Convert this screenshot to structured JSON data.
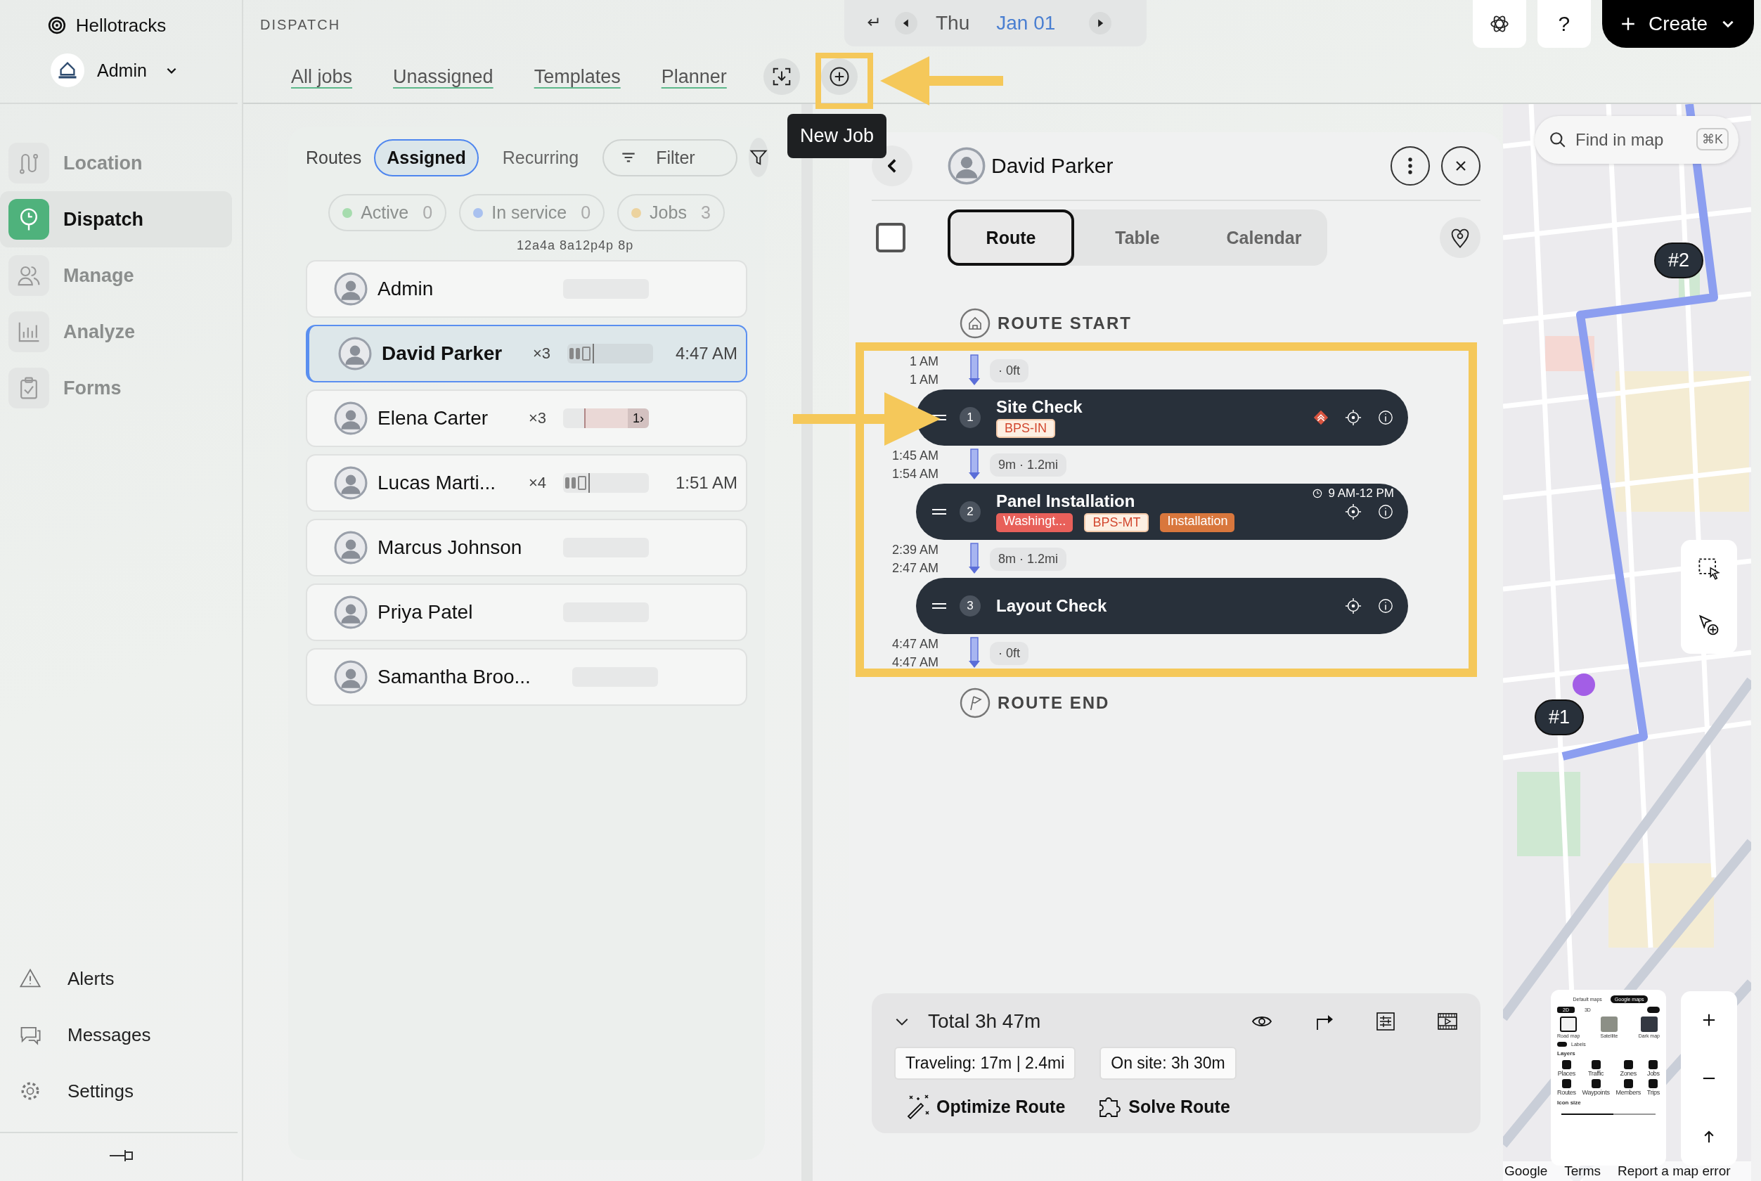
{
  "app": {
    "name": "Hellotracks"
  },
  "account": {
    "name": "Admin"
  },
  "nav": [
    {
      "label": "Location",
      "selected": false
    },
    {
      "label": "Dispatch",
      "selected": true
    },
    {
      "label": "Manage",
      "selected": false
    },
    {
      "label": "Analyze",
      "selected": false
    },
    {
      "label": "Forms",
      "selected": false
    }
  ],
  "nav_bottom": [
    {
      "label": "Alerts"
    },
    {
      "label": "Messages"
    },
    {
      "label": "Settings"
    }
  ],
  "header": {
    "section": "DISPATCH",
    "tabs": [
      "All jobs",
      "Unassigned",
      "Templates",
      "Planner"
    ],
    "tooltip": "New Job"
  },
  "date": {
    "weekday": "Thu",
    "date": "Jan 01"
  },
  "actions": {
    "help": "?",
    "create": "Create"
  },
  "routes_panel": {
    "label": "Routes",
    "modes": [
      {
        "label": "Assigned",
        "selected": true
      },
      {
        "label": "Recurring",
        "selected": false
      }
    ],
    "filter": "Filter",
    "statuses": [
      {
        "label": "Active",
        "count": "0",
        "color": "#a6dcae"
      },
      {
        "label": "In service",
        "count": "0",
        "color": "#a9c1ef"
      },
      {
        "label": "Jobs",
        "count": "3",
        "color": "#ecd39f"
      }
    ],
    "axis": "12a4a 8a12p4p 8p",
    "drivers": [
      {
        "name": "Admin",
        "selected": false,
        "timeline": {
          "kind": "empty"
        }
      },
      {
        "name": "David Parker",
        "selected": true,
        "count": "×3",
        "time": "4:47 AM",
        "timeline": {
          "kind": "stops"
        }
      },
      {
        "name": "Elena Carter",
        "selected": false,
        "count": "×3",
        "timeline": {
          "kind": "overdue",
          "label": "1›"
        }
      },
      {
        "name": "Lucas Marti...",
        "selected": false,
        "count": "×4",
        "time": "1:51 AM",
        "timeline": {
          "kind": "stops"
        }
      },
      {
        "name": "Marcus Johnson",
        "selected": false,
        "timeline": {
          "kind": "empty"
        }
      },
      {
        "name": "Priya Patel",
        "selected": false,
        "timeline": {
          "kind": "empty"
        }
      },
      {
        "name": "Samantha Broo...",
        "selected": false,
        "timeline": {
          "kind": "empty"
        }
      }
    ]
  },
  "route": {
    "driver": "David Parker",
    "checked": false,
    "views": [
      {
        "label": "Route",
        "selected": true
      },
      {
        "label": "Table",
        "selected": false
      },
      {
        "label": "Calendar",
        "selected": false
      }
    ],
    "start": "ROUTE START",
    "end": "ROUTE END",
    "legs": [
      {
        "arrive": "1 AM",
        "depart": "1 AM",
        "travel": "· 0ft"
      },
      {
        "arrive": "1:45 AM",
        "depart": "1:54 AM",
        "travel": "9m · 1.2mi"
      },
      {
        "arrive": "2:39 AM",
        "depart": "2:47 AM",
        "travel": "8m · 1.2mi"
      },
      {
        "arrive": "4:47 AM",
        "depart": "4:47 AM",
        "travel": "· 0ft"
      }
    ],
    "stops": [
      {
        "number": "1",
        "title": "Site Check",
        "priority": true,
        "tags": [
          {
            "label": "BPS-IN",
            "kind": "outline"
          }
        ]
      },
      {
        "number": "2",
        "title": "Panel Installation",
        "priority": false,
        "window": "9 AM-12 PM",
        "tags": [
          {
            "label": "Washingt...",
            "kind": "filled",
            "color": "#e8605a"
          },
          {
            "label": "BPS-MT",
            "kind": "outline"
          },
          {
            "label": "Installation",
            "kind": "filled",
            "color": "#d9773d"
          }
        ]
      },
      {
        "number": "3",
        "title": "Layout Check",
        "priority": false
      }
    ],
    "summary": {
      "total": "Total 3h 47m",
      "traveling": "Traveling: 17m | 2.4mi",
      "onsite": "On site: 3h 30m",
      "optimize": "Optimize Route",
      "solve": "Solve Route"
    }
  },
  "map": {
    "search": {
      "placeholder": "Find in map",
      "shortcut": "⌘K"
    },
    "pins": [
      "#2",
      "#1"
    ],
    "style_panel": {
      "sources": [
        {
          "label": "Default maps",
          "selected": false
        },
        {
          "label": "Google maps",
          "selected": true
        }
      ],
      "dims": [
        {
          "label": "2D",
          "selected": true
        },
        {
          "label": "3D",
          "selected": false
        }
      ],
      "dims_toggle_on": true,
      "types": [
        "Road map",
        "Satellite",
        "Dark map"
      ],
      "labels": "Labels",
      "labels_on": true,
      "layers_title": "Layers",
      "layers": [
        "Places",
        "Traffic",
        "Zones",
        "Jobs",
        "Routes",
        "Waypoints",
        "Members",
        "Trips"
      ],
      "icon_size": "Icon size",
      "level": 0.55
    },
    "footer": [
      "Google",
      "Terms",
      "Report a map error"
    ]
  }
}
